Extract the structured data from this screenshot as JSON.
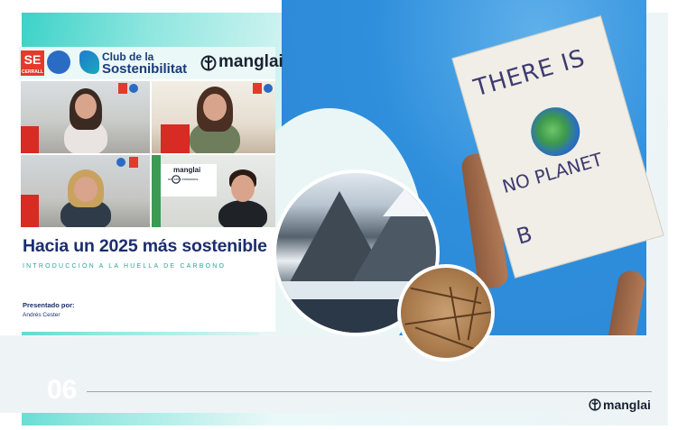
{
  "slide": {
    "number": "06",
    "footer_brand": "manglai"
  },
  "video_panel": {
    "logos": {
      "cerrall_letters": "SE",
      "cerrall_name": "CERRALL",
      "club_line1": "Club de la",
      "club_line2": "Sostenibilitat",
      "manglai": "manglai"
    },
    "participant_tiles": [
      {
        "label": "participant 1"
      },
      {
        "label": "participant 2"
      },
      {
        "label": "participant 3"
      },
      {
        "label": "participant 4"
      }
    ],
    "tile4_screen": {
      "brand": "manglai",
      "caption": "net zero emissions"
    },
    "headline": "Hacia un 2025 más sostenible",
    "subheadline": "INTRODUCCIÓN A LA HUELLA DE CARBONO",
    "presented_by_label": "Presentado por:",
    "presenter_name": "Andrés Cester"
  },
  "photo": {
    "sign_line1": "THERE IS",
    "sign_line2": "NO PLANET",
    "sign_line3": "B"
  },
  "colors": {
    "teal": "#3cd2c8",
    "navy": "#1b2e6e",
    "red": "#e43a2c",
    "sky": "#2f8fdc"
  },
  "icons": [
    "manglai-logo-icon",
    "club-sostenibilitat-icon",
    "globe-icon"
  ]
}
